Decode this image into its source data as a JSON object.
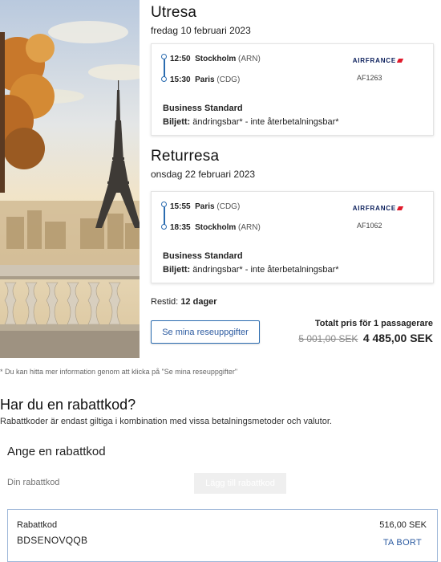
{
  "outbound": {
    "title": "Utresa",
    "date": "fredag 10 februari 2023",
    "depart_time": "12:50",
    "depart_city": "Stockholm",
    "depart_airport": "(ARN)",
    "arrive_time": "15:30",
    "arrive_city": "Paris",
    "arrive_airport": "(CDG)",
    "airline": "AIRFRANCE",
    "flight_number": "AF1263",
    "cabin": "Business Standard",
    "ticket_label": "Biljett:",
    "ticket_terms": "ändringsbar* - inte återbetalningsbar*"
  },
  "return": {
    "title": "Returresa",
    "date": "onsdag 22 februari 2023",
    "depart_time": "15:55",
    "depart_city": "Paris",
    "depart_airport": "(CDG)",
    "arrive_time": "18:35",
    "arrive_city": "Stockholm",
    "arrive_airport": "(ARN)",
    "airline": "AIRFRANCE",
    "flight_number": "AF1062",
    "cabin": "Business Standard",
    "ticket_label": "Biljett:",
    "ticket_terms": "ändringsbar* - inte återbetalningsbar*"
  },
  "summary": {
    "travel_time_label": "Restid:",
    "travel_time_value": "12 dager",
    "details_button": "Se mina reseuppgifter",
    "total_label": "Totalt pris för 1 passagerare",
    "old_price": "5 001,00 SEK",
    "new_price": "4 485,00 SEK"
  },
  "footnote": "* Du kan hitta mer information genom att klicka på \"Se mina reseuppgifter\"",
  "discount": {
    "heading": "Har du en rabattkod?",
    "subheading": "Rabattkoder är endast giltiga i kombination med vissa betalningsmetoder och valutor.",
    "box_title": "Ange en rabattkod",
    "input_placeholder": "Din rabattkod",
    "add_button": "Lägg till rabattkod",
    "applied_label": "Rabattkod",
    "applied_code": "BDSENOVQQB",
    "applied_amount": "516,00 SEK",
    "remove_label": "TA BORT"
  },
  "colors": {
    "accent": "#2b6cb0",
    "airfrance_navy": "#0a1e5b",
    "airfrance_red": "#e01a2b"
  }
}
